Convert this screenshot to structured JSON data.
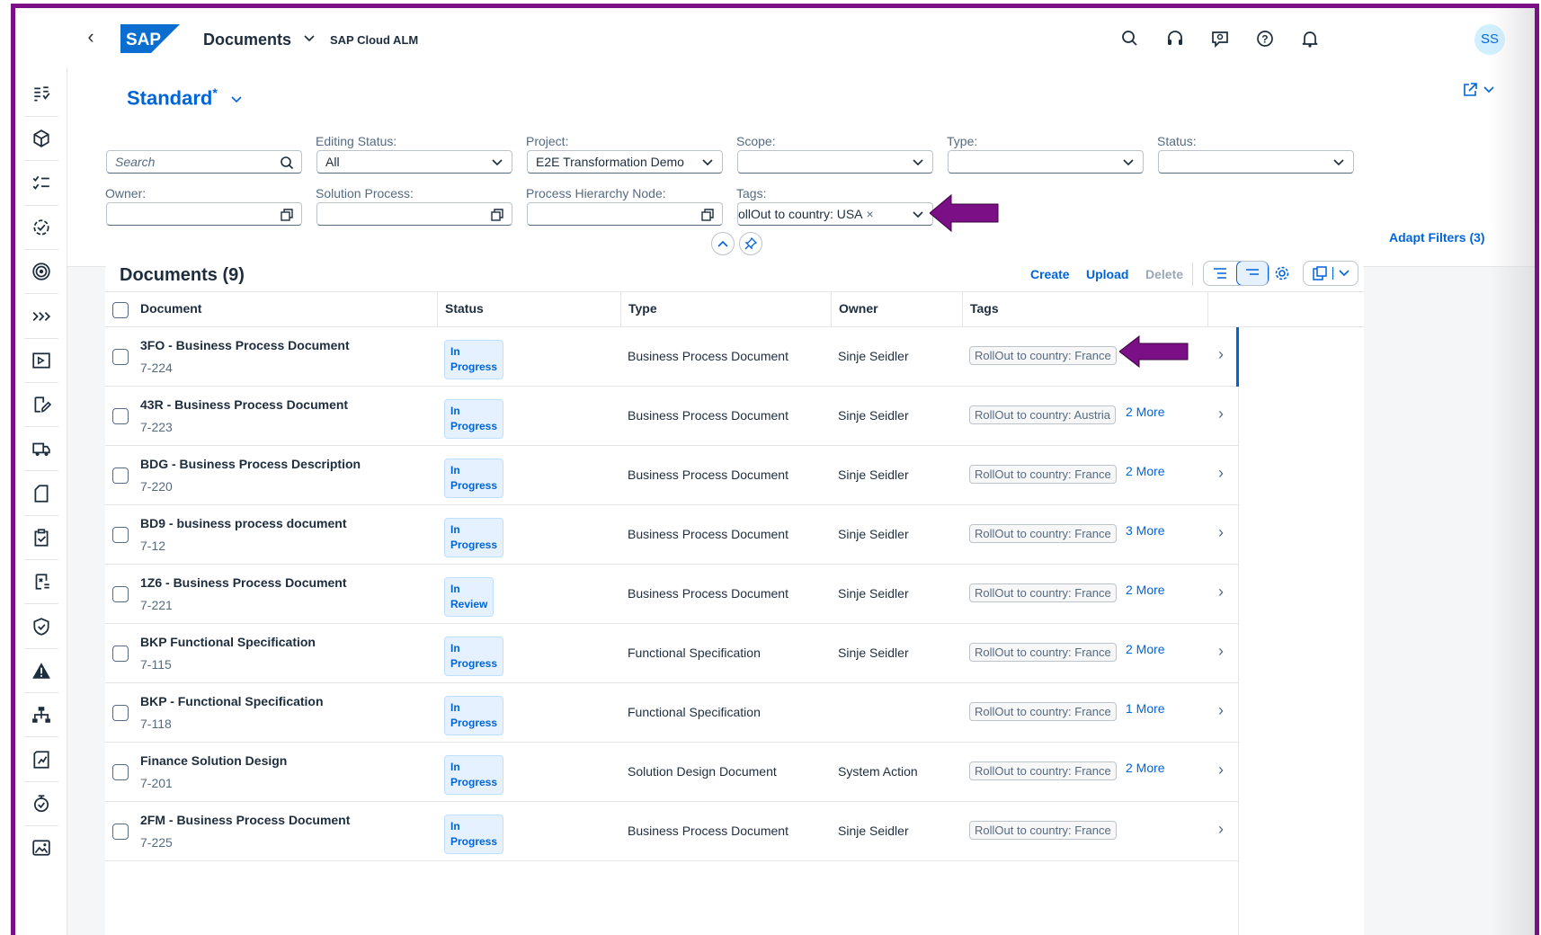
{
  "shell": {
    "app_title": "Documents",
    "product": "SAP Cloud ALM",
    "avatar": "SS",
    "logo_text": "SAP"
  },
  "side_nav": [
    "requirements-icon",
    "cube-icon",
    "checklist-icon",
    "process-check-icon",
    "target-icon",
    "chevrons-icon",
    "presentation-icon",
    "edit-doc-icon",
    "truck-icon",
    "document-icon",
    "clipboard-check-icon",
    "form-cross-icon",
    "shield-check-icon",
    "alert-icon",
    "network-icon",
    "chart-doc-icon",
    "badge-icon",
    "image-icon"
  ],
  "variant": {
    "name": "Standard",
    "modified_marker": "*"
  },
  "filters": {
    "search_placeholder": "Search",
    "editing_status": {
      "label": "Editing Status:",
      "value": "All"
    },
    "project": {
      "label": "Project:",
      "value": "E2E Transformation Demo"
    },
    "scope": {
      "label": "Scope:",
      "value": ""
    },
    "type": {
      "label": "Type:",
      "value": ""
    },
    "status": {
      "label": "Status:",
      "value": ""
    },
    "owner": {
      "label": "Owner:",
      "value": ""
    },
    "solution_process": {
      "label": "Solution Process:",
      "value": ""
    },
    "process_hierarchy_node": {
      "label": "Process Hierarchy Node:",
      "value": ""
    },
    "tags": {
      "label": "Tags:",
      "token": "ollOut to country: USA",
      "remove": "×"
    },
    "adapt": "Adapt Filters (3)"
  },
  "table": {
    "title": "Documents (9)",
    "actions": {
      "create": "Create",
      "upload": "Upload",
      "delete": "Delete"
    },
    "columns": [
      "Document",
      "Status",
      "Type",
      "Owner",
      "Tags"
    ],
    "rows": [
      {
        "name": "3FO - Business Process Document",
        "id": "7-224",
        "status": [
          "In",
          "Progress"
        ],
        "type": "Business Process Document",
        "owner": "Sinje Seidler",
        "tag": "RollOut to country: France",
        "more": ""
      },
      {
        "name": "43R - Business Process Document",
        "id": "7-223",
        "status": [
          "In",
          "Progress"
        ],
        "type": "Business Process Document",
        "owner": "Sinje Seidler",
        "tag": "RollOut to country: Austria",
        "more": "2 More"
      },
      {
        "name": "BDG - Business Process Description",
        "id": "7-220",
        "status": [
          "In",
          "Progress"
        ],
        "type": "Business Process Document",
        "owner": "Sinje Seidler",
        "tag": "RollOut to country: France",
        "more": "2 More"
      },
      {
        "name": "BD9 - business process document",
        "id": "7-12",
        "status": [
          "In",
          "Progress"
        ],
        "type": "Business Process Document",
        "owner": "Sinje Seidler",
        "tag": "RollOut to country: France",
        "more": "3 More"
      },
      {
        "name": "1Z6 - Business Process Document",
        "id": "7-221",
        "status": [
          "In",
          "Review"
        ],
        "type": "Business Process Document",
        "owner": "Sinje Seidler",
        "tag": "RollOut to country: France",
        "more": "2 More"
      },
      {
        "name": "BKP Functional Specification",
        "id": "7-115",
        "status": [
          "In",
          "Progress"
        ],
        "type": "Functional Specification",
        "owner": "Sinje Seidler",
        "tag": "RollOut to country: France",
        "more": "2 More"
      },
      {
        "name": "BKP - Functional Specification",
        "id": "7-118",
        "status": [
          "In",
          "Progress"
        ],
        "type": "Functional Specification",
        "owner": "",
        "tag": "RollOut to country: France",
        "more": "1 More"
      },
      {
        "name": "Finance Solution Design",
        "id": "7-201",
        "status": [
          "In",
          "Progress"
        ],
        "type": "Solution Design Document",
        "owner": "System Action",
        "tag": "RollOut to country: France",
        "more": "2 More"
      },
      {
        "name": "2FM - Business Process Document",
        "id": "7-225",
        "status": [
          "In",
          "Progress"
        ],
        "type": "Business Process Document",
        "owner": "Sinje Seidler",
        "tag": "RollOut to country: France",
        "more": ""
      }
    ]
  },
  "colors": {
    "accent": "#0064d9",
    "annotation_arrow": "#7b0f86",
    "frame": "#7b0f86"
  }
}
